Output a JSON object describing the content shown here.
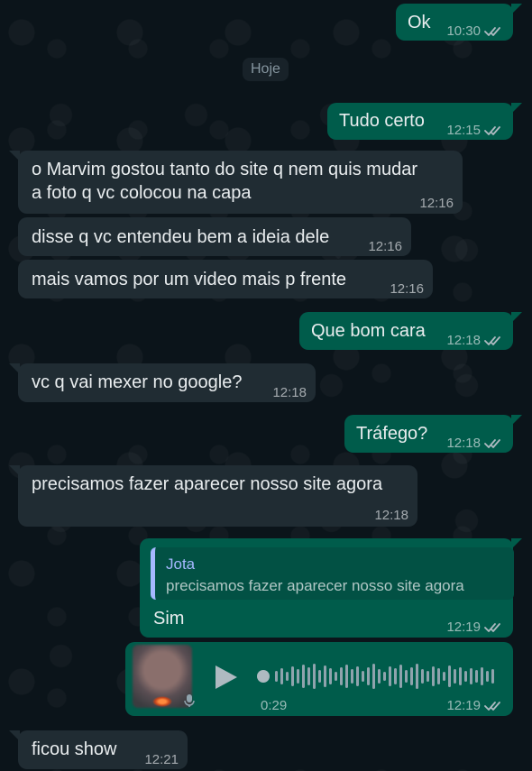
{
  "date_divider": "Hoje",
  "messages": [
    {
      "text": "Ok",
      "time": "10:30"
    },
    {
      "text": "Tudo certo",
      "time": "12:15"
    },
    {
      "line1": "o Marvim gostou tanto do site q nem quis mudar",
      "line2": "a foto q vc colocou na capa",
      "time": "12:16"
    },
    {
      "text": "disse q vc entendeu bem a ideia dele",
      "time": "12:16"
    },
    {
      "text": "mais vamos por um video mais p frente",
      "time": "12:16"
    },
    {
      "text": "Que bom cara",
      "time": "12:18"
    },
    {
      "text": "vc q vai mexer no google?",
      "time": "12:18"
    },
    {
      "text": "Tráfego?",
      "time": "12:18"
    },
    {
      "text": "precisamos fazer aparecer nosso site agora",
      "time": "12:18"
    },
    {
      "quote_author": "Jota",
      "quote_text": "precisamos fazer aparecer nosso site agora",
      "text": "Sim",
      "time": "12:19"
    },
    {
      "voice_duration": "0:29",
      "time": "12:19"
    },
    {
      "text": "ficou show",
      "time": "12:21"
    }
  ],
  "colors": {
    "background": "#0b141a",
    "outgoing_bubble": "#005c4b",
    "incoming_bubble": "#202c33",
    "read_ticks": "#aebac1",
    "quote_author": "#a5b8ff"
  },
  "icons": [
    "double-check-icon",
    "play-icon",
    "microphone-icon",
    "waveform-icon"
  ]
}
